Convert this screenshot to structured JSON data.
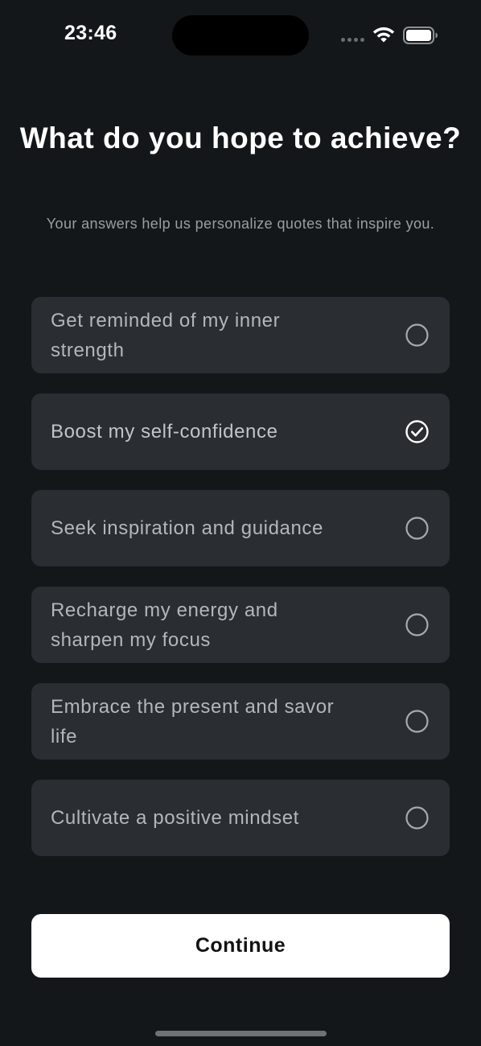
{
  "status_bar": {
    "time": "23:46",
    "icons": [
      "signal-dots-icon",
      "wifi-icon",
      "battery-icon"
    ]
  },
  "header": {
    "title": "What do you hope to achieve?",
    "subtitle": "Your answers help us personalize quotes that inspire you."
  },
  "options": [
    {
      "label": "Get reminded of my inner strength",
      "selected": false
    },
    {
      "label": "Boost my self-confidence",
      "selected": true
    },
    {
      "label": "Seek inspiration and guidance",
      "selected": false
    },
    {
      "label": "Recharge my energy and sharpen my focus",
      "selected": false
    },
    {
      "label": "Embrace the present and savor life",
      "selected": false
    },
    {
      "label": "Cultivate a positive mindset",
      "selected": false
    }
  ],
  "continue_button": {
    "label": "Continue"
  },
  "colors": {
    "background": "#141719",
    "option_background": "#2a2d31",
    "option_text": "#b4b7ba",
    "subtitle_text": "#9a9ea2",
    "button_background": "#ffffff",
    "button_text": "#111315"
  }
}
